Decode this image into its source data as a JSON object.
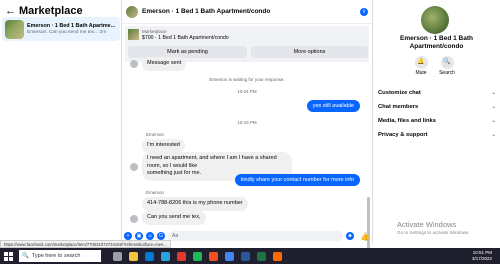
{
  "sidebar": {
    "title": "Marketplace",
    "conversation": {
      "name": "Emerson · 1 Bed 1 Bath Apartme...",
      "preview": "Emerson: Can you send me tex... 2m"
    }
  },
  "chat": {
    "header_title": "Emerson · 1 Bed 1 Bath Apartment/condo",
    "listing": {
      "source": "Marketplace",
      "price_title": "$700 · 1 Bed 1 Bath Apartment/condo",
      "mark_pending": "Mark as pending",
      "more_options": "More options"
    },
    "messages": {
      "msg_sent": "Message sent",
      "waiting": "Emerson is waiting for your response.",
      "time1": "10:24 PM",
      "out1": "yes still available",
      "time2": "10:43 PM",
      "sender1": "Emerson",
      "in1": "I'm interested",
      "in2_line1": "I need an apartment, and where I am I have a shared room, so I would like",
      "in2_line2": "something just for me.",
      "out2": "kindly share your contact number for more info",
      "sender2": "Emerson",
      "in3": "414-788-8206 this is my phone number",
      "in4": "Can you send me tex,"
    },
    "composer_placeholder": "Aa"
  },
  "right_panel": {
    "title_line1": "Emerson · 1 Bed 1 Bath",
    "title_line2": "Apartment/condo",
    "mute": "Mute",
    "search": "Search",
    "rows": [
      "Customize chat",
      "Chat members",
      "Media, files and links",
      "Privacy & support"
    ],
    "watermark_title": "Activate Windows",
    "watermark_sub": "Go to Settings to activate Windows."
  },
  "status_url": "https://www.facebook.com/marketplace/item/770031072734159/?referralSurface=mes...",
  "taskbar": {
    "search_placeholder": "Type here to search",
    "time": "10:51 PM",
    "date": "3/17/2022"
  }
}
